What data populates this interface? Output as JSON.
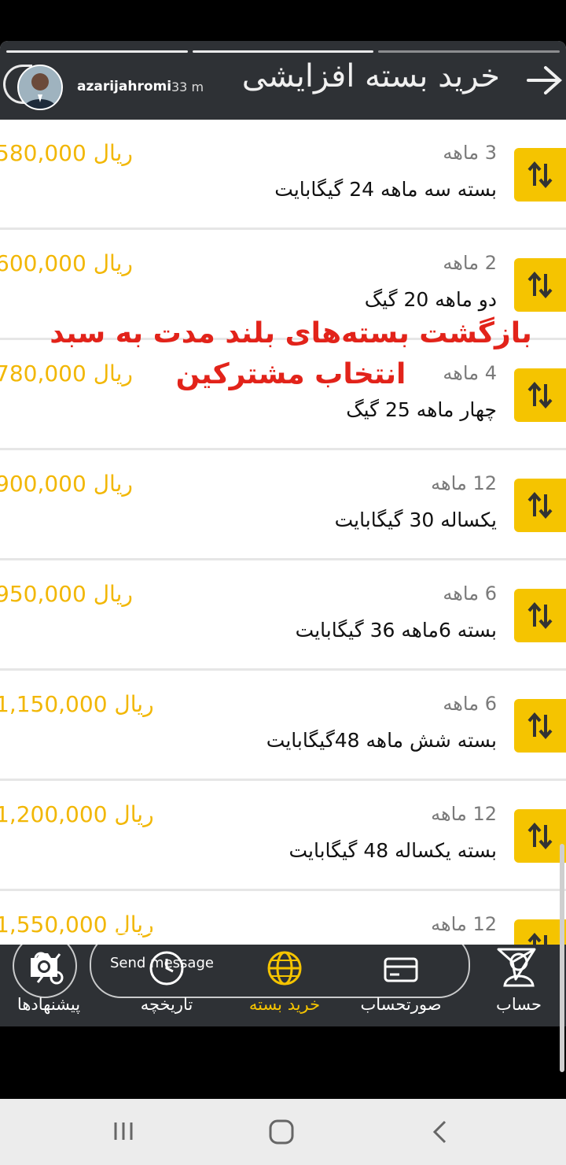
{
  "story": {
    "username": "azarijahromi",
    "time": "33 m",
    "send_placeholder": "Send message",
    "caption_line1": "بازگشت بسته‌های بلند مدت به سبد",
    "caption_line2": "انتخاب مشترکین"
  },
  "header": {
    "title": "خرید بسته افزایشی"
  },
  "packages": [
    {
      "price": "580,000 ریال",
      "duration": "3 ماهه",
      "name": "بسته سه ماهه 24 گیگابایت"
    },
    {
      "price": "600,000 ریال",
      "duration": "2 ماهه",
      "name": "دو ماهه 20 گیگ"
    },
    {
      "price": "780,000 ریال",
      "duration": "4 ماهه",
      "name": "چهار ماهه 25 گیگ"
    },
    {
      "price": "900,000 ریال",
      "duration": "12 ماهه",
      "name": "یکساله 30 گیگابایت"
    },
    {
      "price": "950,000 ریال",
      "duration": "6 ماهه",
      "name": "بسته 6ماهه 36 گیگابایت"
    },
    {
      "price": "1,150,000 ریال",
      "duration": "6 ماهه",
      "name": "بسته شش ماهه 48گیگابایت"
    },
    {
      "price": "1,200,000 ریال",
      "duration": "12 ماهه",
      "name": "بسته یکساله 48 گیگابایت"
    },
    {
      "price": "1,550,000 ریال",
      "duration": "12 ماهه",
      "name": ""
    }
  ],
  "bottom_nav": {
    "account": "حساب",
    "bill": "صورتحساب",
    "buy_package": "خرید بسته",
    "history": "تاریخچه",
    "offers": "پیشنهادها"
  },
  "colors": {
    "accent": "#f5c400",
    "price": "#f2b705",
    "caption": "#e2231a",
    "bar": "#2e3135"
  }
}
